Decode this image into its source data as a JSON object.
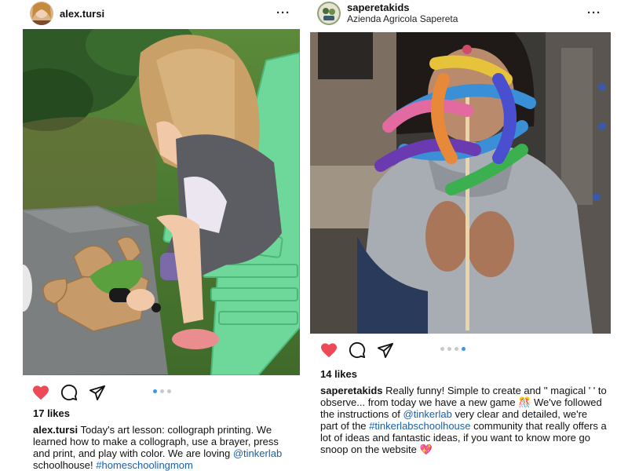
{
  "posts": [
    {
      "username": "alex.tursi",
      "more_label": "···",
      "likes": "17 likes",
      "carousel": {
        "count": 3,
        "active": 0
      },
      "liked": true,
      "caption_parts": [
        {
          "kind": "user",
          "text": "alex.tursi"
        },
        {
          "kind": "text",
          "text": " Today's art lesson: collograph printing. We learned how to make a collograph, use a brayer, press and print, and play with color. We are loving "
        },
        {
          "kind": "tag",
          "text": "@tinkerlab"
        },
        {
          "kind": "text",
          "text": " schoolhouse! "
        },
        {
          "kind": "tag",
          "text": "#homeschoolingmom"
        }
      ]
    },
    {
      "username": "saperetakids",
      "location": "Azienda Agricola Sapereta",
      "more_label": "···",
      "likes": "14 likes",
      "carousel": {
        "count": 4,
        "active": 3
      },
      "liked": true,
      "caption_parts": [
        {
          "kind": "user",
          "text": "saperetakids"
        },
        {
          "kind": "text",
          "text": " Really funny! Simple to create and '' magical ' ' to observe... from today we have a new game 🎊 We've followed the instructions of "
        },
        {
          "kind": "tag",
          "text": "@tinkerlab"
        },
        {
          "kind": "text",
          "text": " very clear and detailed, we're part of the "
        },
        {
          "kind": "tag",
          "text": "#tinkerlabschoolhouse"
        },
        {
          "kind": "text",
          "text": " community that really offers a lot of ideas and fantastic ideas, if you want to know more go snoop on the website "
        },
        {
          "kind": "emoji",
          "text": "💖"
        }
      ]
    }
  ],
  "colors": {
    "heart": "#ed4956",
    "link": "#1b5fa8",
    "dot_active": "#3897f0",
    "dot_inactive": "#c9c9c9"
  },
  "icons": [
    "heart-icon",
    "comment-icon",
    "share-icon",
    "more-options-icon"
  ]
}
